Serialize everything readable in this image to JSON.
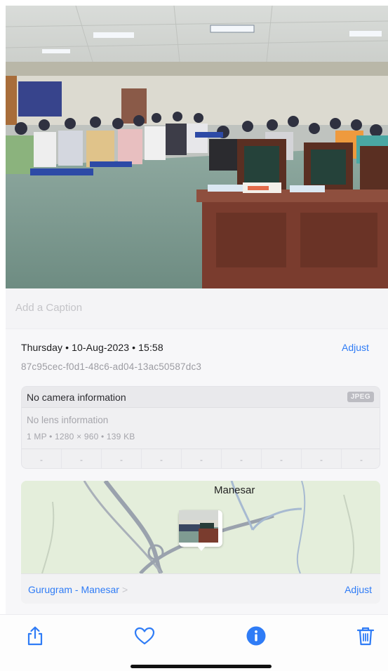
{
  "caption": {
    "placeholder": "Add a Caption"
  },
  "info": {
    "datetime": "Thursday • 10-Aug-2023 • 15:58",
    "adjust_label": "Adjust",
    "uuid": "87c95cec-f0d1-48c6-ad04-13ac50587dc3"
  },
  "camera": {
    "title": "No camera information",
    "format_badge": "JPEG",
    "lens": "No lens information",
    "specs": "1 MP  •  1280 × 960  •  139 KB",
    "exif_values": [
      "-",
      "-",
      "-",
      "-",
      "-",
      "-",
      "-",
      "-",
      "-"
    ]
  },
  "map": {
    "city_label": "Manesar",
    "place": "Gurugram - Manesar",
    "place_chevron": ">",
    "adjust_label": "Adjust"
  },
  "toolbar": {
    "icons": [
      "share-icon",
      "heart-icon",
      "info-icon",
      "trash-icon"
    ]
  },
  "colors": {
    "accent": "#2f7cf6",
    "map_bg": "#e4eedb"
  }
}
